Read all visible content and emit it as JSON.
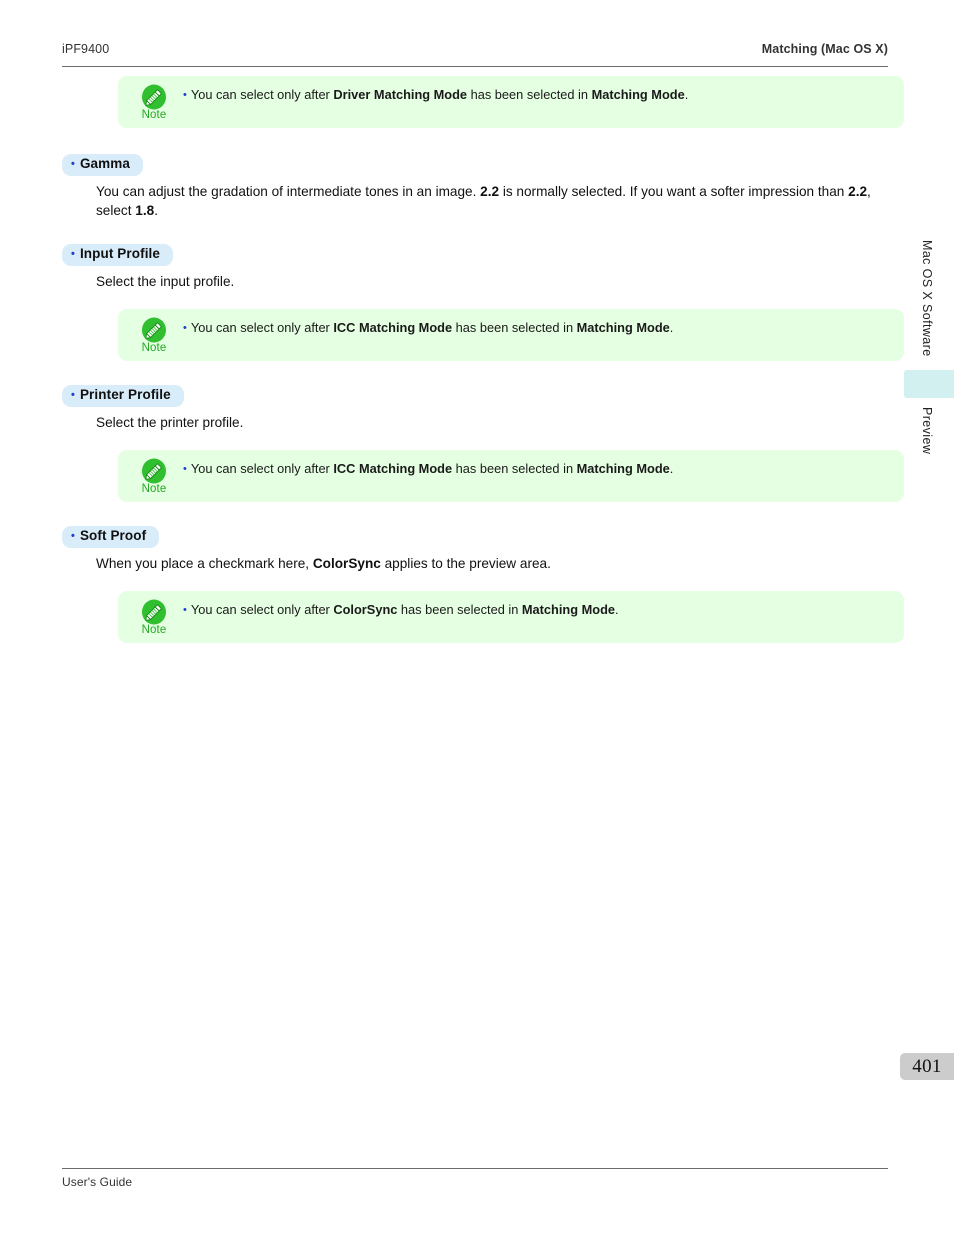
{
  "header": {
    "left": "iPF9400",
    "right": "Matching (Mac OS X)"
  },
  "notes": {
    "note_label": "Note",
    "bullet": "•",
    "icon_name": "note-pencil-icon"
  },
  "note_top": {
    "text_1": "You can select only after ",
    "bold_1": "Driver Matching Mode",
    "text_2": " has been selected in ",
    "bold_2": "Matching Mode",
    "text_3": "."
  },
  "sections": [
    {
      "heading": "Gamma",
      "body_parts": [
        {
          "t": "You can adjust the gradation of intermediate tones in an image. ",
          "b": false
        },
        {
          "t": "2.2",
          "b": true
        },
        {
          "t": " is normally selected. If you want a softer impression than ",
          "b": false
        },
        {
          "t": "2.2",
          "b": true
        },
        {
          "t": ", select ",
          "b": false
        },
        {
          "t": "1.8",
          "b": true
        },
        {
          "t": ".",
          "b": false
        }
      ],
      "note": null
    },
    {
      "heading": "Input Profile",
      "body_parts": [
        {
          "t": "Select the input profile.",
          "b": false
        }
      ],
      "note": {
        "text_1": "You can select only after ",
        "bold_1": "ICC Matching Mode",
        "text_2": " has been selected in ",
        "bold_2": "Matching Mode",
        "text_3": "."
      }
    },
    {
      "heading": "Printer Profile",
      "body_parts": [
        {
          "t": "Select the printer profile.",
          "b": false
        }
      ],
      "note": {
        "text_1": "You can select only after ",
        "bold_1": "ICC Matching Mode",
        "text_2": " has been selected in ",
        "bold_2": "Matching Mode",
        "text_3": "."
      }
    },
    {
      "heading": "Soft Proof",
      "body_parts": [
        {
          "t": "When you place a checkmark here, ",
          "b": false
        },
        {
          "t": "ColorSync",
          "b": true
        },
        {
          "t": " applies to the preview area.",
          "b": false
        }
      ],
      "note": {
        "text_1": "You can select only after ",
        "bold_1": "ColorSync",
        "text_2": " has been selected in ",
        "bold_2": "Matching Mode",
        "text_3": "."
      }
    }
  ],
  "sidebar": {
    "label_1": "Mac OS X Software",
    "label_2": "Preview",
    "tab_color": "#d2f0f0"
  },
  "page_number": "401",
  "footer": {
    "text": "User's Guide"
  },
  "colors": {
    "note_bg": "#e4ffe1",
    "heading_pill": "#d9ecfa",
    "note_green": "#22aa22",
    "bullet_blue": "#1c3fd1",
    "page_num_bg": "#cccccc"
  }
}
